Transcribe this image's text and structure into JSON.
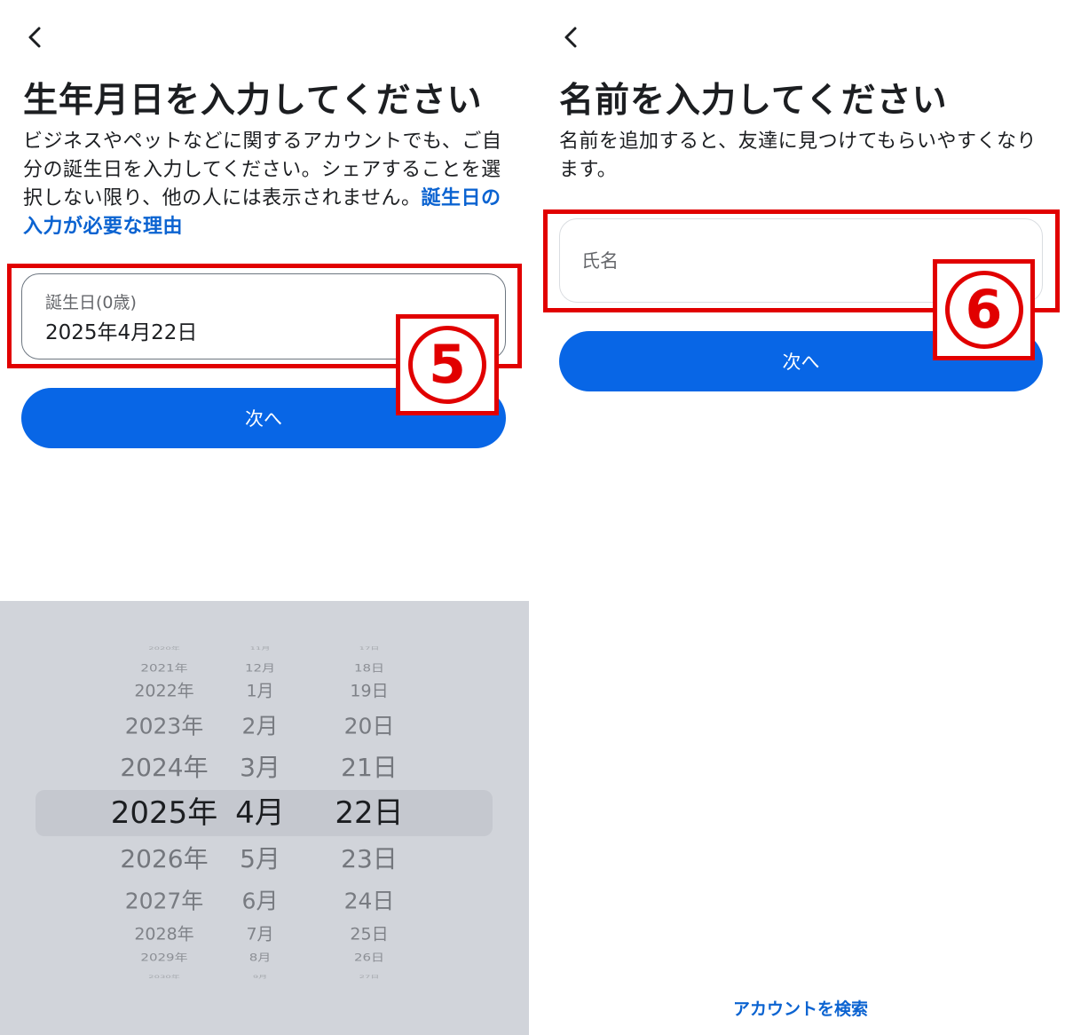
{
  "left": {
    "title": "生年月日を入力してください",
    "description": "ビジネスやペットなどに関するアカウントでも、ご自分の誕生日を入力してください。シェアすることを選択しない限り、他の人には表示されません。",
    "description_link": "誕生日の入力が必要な理由",
    "birthday_label": "誕生日(0歳)",
    "birthday_value": "2025年4月22日",
    "next_label": "次へ",
    "badge": "5",
    "picker": {
      "years": [
        "2020年",
        "2021年",
        "2022年",
        "2023年",
        "2024年",
        "2025年",
        "2026年",
        "2027年",
        "2028年",
        "2029年",
        "2030年"
      ],
      "months": [
        "11月",
        "12月",
        "1月",
        "2月",
        "3月",
        "4月",
        "5月",
        "6月",
        "7月",
        "8月",
        "9月"
      ],
      "days": [
        "17日",
        "18日",
        "19日",
        "20日",
        "21日",
        "22日",
        "23日",
        "24日",
        "25日",
        "26日",
        "27日"
      ],
      "selected_index": 5
    }
  },
  "right": {
    "title": "名前を入力してください",
    "description": "名前を追加すると、友達に見つけてもらいやすくなります。",
    "name_placeholder": "氏名",
    "next_label": "次へ",
    "badge": "6",
    "search_account": "アカウントを検索"
  },
  "colors": {
    "primary_button": "#0866e6",
    "link": "#0b63d1",
    "annotation_red": "#e10000",
    "picker_bg": "#d1d4da"
  },
  "icons": {
    "back": "chevron-left-icon"
  }
}
